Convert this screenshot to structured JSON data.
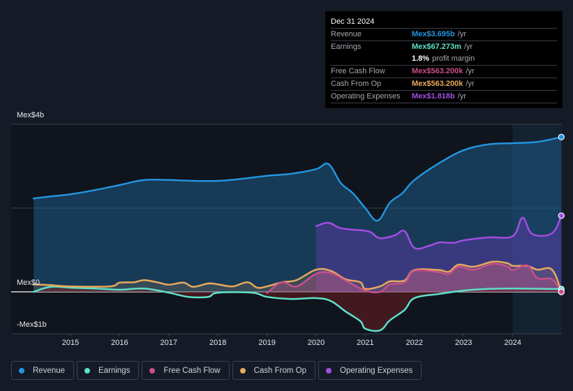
{
  "tooltip": {
    "date": "Dec 31 2024",
    "rows": [
      {
        "label": "Revenue",
        "value": "Mex$3.695b",
        "unit": "/yr",
        "color": "#2394df"
      },
      {
        "label": "Earnings",
        "value": "Mex$67.273m",
        "unit": "/yr",
        "color": "#5ee1c9"
      },
      {
        "label": "",
        "value": "1.8%",
        "unit": "profit margin",
        "color": "#ffffff"
      },
      {
        "label": "Free Cash Flow",
        "value": "Mex$563.200k",
        "unit": "/yr",
        "color": "#c94f8a"
      },
      {
        "label": "Cash From Op",
        "value": "Mex$563.200k",
        "unit": "/yr",
        "color": "#e8a95c"
      },
      {
        "label": "Operating Expenses",
        "value": "Mex$1.818b",
        "unit": "/yr",
        "color": "#a24ee0"
      }
    ]
  },
  "legend": [
    {
      "label": "Revenue",
      "color": "#2394df"
    },
    {
      "label": "Earnings",
      "color": "#5ee1c9"
    },
    {
      "label": "Free Cash Flow",
      "color": "#c94f8a"
    },
    {
      "label": "Cash From Op",
      "color": "#e8a95c"
    },
    {
      "label": "Operating Expenses",
      "color": "#a24ee0"
    }
  ],
  "chart_data": {
    "type": "area",
    "title": "",
    "xlabel": "",
    "ylabel": "",
    "units": "Mex$ billions",
    "xlim": [
      2014.25,
      2024.99
    ],
    "ylim": [
      -1,
      4
    ],
    "y_tick_labels": [
      {
        "value": 4,
        "label": "Mex$4b"
      },
      {
        "value": 0,
        "label": "Mex$0"
      },
      {
        "value": -1,
        "label": "-Mex$1b"
      }
    ],
    "gridlines": [
      4,
      2,
      0
    ],
    "x_ticks": [
      2015,
      2016,
      2017,
      2018,
      2019,
      2020,
      2021,
      2022,
      2023,
      2024
    ],
    "x_tick_labels": [
      "2015",
      "2016",
      "2017",
      "2018",
      "2019",
      "2020",
      "2021",
      "2022",
      "2023",
      "2024"
    ],
    "highlight_from": 2024,
    "legend_position": "bottom",
    "series": [
      {
        "name": "Revenue",
        "color": "#2394df",
        "x": [
          2014.25,
          2014.6,
          2015,
          2015.5,
          2016,
          2016.5,
          2017,
          2017.5,
          2018,
          2018.5,
          2019,
          2019.5,
          2020,
          2020.25,
          2020.5,
          2020.75,
          2021,
          2021.25,
          2021.5,
          2021.75,
          2022,
          2022.5,
          2023,
          2023.5,
          2024,
          2024.5,
          2024.99
        ],
        "values": [
          2.23,
          2.28,
          2.33,
          2.43,
          2.55,
          2.67,
          2.67,
          2.65,
          2.65,
          2.7,
          2.77,
          2.82,
          2.93,
          3.05,
          2.6,
          2.35,
          2.0,
          1.7,
          2.13,
          2.35,
          2.67,
          3.07,
          3.38,
          3.52,
          3.55,
          3.58,
          3.695
        ]
      },
      {
        "name": "Earnings",
        "color": "#5ee1c9",
        "x": [
          2014.25,
          2014.6,
          2015,
          2015.5,
          2016,
          2016.5,
          2017,
          2017.4,
          2017.8,
          2018,
          2018.7,
          2019,
          2019.5,
          2020,
          2020.3,
          2020.6,
          2020.9,
          2021,
          2021.3,
          2021.5,
          2021.8,
          2022,
          2022.5,
          2023,
          2023.5,
          2024,
          2024.99
        ],
        "values": [
          0.0,
          0.12,
          0.1,
          0.08,
          0.05,
          0.08,
          -0.02,
          -0.12,
          -0.12,
          -0.02,
          -0.02,
          -0.12,
          -0.17,
          -0.15,
          -0.22,
          -0.47,
          -0.7,
          -0.88,
          -0.92,
          -0.68,
          -0.43,
          -0.15,
          -0.05,
          0.03,
          0.07,
          0.08,
          0.067
        ]
      },
      {
        "name": "Free Cash Flow",
        "color": "#c94f8a",
        "x": [
          2019.0,
          2019.3,
          2019.6,
          2020,
          2020.3,
          2020.6,
          2021,
          2021.3,
          2021.5,
          2021.8,
          2022,
          2022.5,
          2022.7,
          2022.9,
          2023.2,
          2023.6,
          2023.9,
          2024,
          2024.3,
          2024.5,
          2024.8,
          2024.99
        ],
        "values": [
          -0.03,
          0.23,
          0.13,
          0.43,
          0.45,
          0.27,
          0.03,
          0.0,
          0.18,
          0.22,
          0.5,
          0.47,
          0.42,
          0.6,
          0.53,
          0.67,
          0.6,
          0.52,
          0.63,
          0.33,
          0.3,
          0.000563
        ]
      },
      {
        "name": "Cash From Op",
        "color": "#e8a95c",
        "x": [
          2014.25,
          2014.6,
          2015,
          2015.8,
          2016,
          2016.3,
          2016.5,
          2016.8,
          2017,
          2017.3,
          2017.5,
          2017.8,
          2018,
          2018.3,
          2018.6,
          2018.8,
          2019,
          2019.3,
          2019.6,
          2020,
          2020.3,
          2020.6,
          2020.9,
          2021,
          2021.3,
          2021.5,
          2021.8,
          2022,
          2022.5,
          2022.7,
          2022.9,
          2023.2,
          2023.6,
          2023.9,
          2024,
          2024.3,
          2024.5,
          2024.8,
          2024.99
        ],
        "values": [
          0.18,
          0.16,
          0.13,
          0.13,
          0.22,
          0.23,
          0.28,
          0.22,
          0.17,
          0.22,
          0.12,
          0.2,
          0.18,
          0.13,
          0.23,
          0.1,
          0.13,
          0.23,
          0.28,
          0.53,
          0.5,
          0.3,
          0.23,
          0.07,
          0.13,
          0.25,
          0.27,
          0.52,
          0.52,
          0.48,
          0.65,
          0.6,
          0.72,
          0.68,
          0.62,
          0.62,
          0.53,
          0.53,
          0.000563
        ]
      },
      {
        "name": "Operating Expenses",
        "color": "#a24ee0",
        "x": [
          2020,
          2020.25,
          2020.5,
          2020.9,
          2021.1,
          2021.3,
          2021.6,
          2021.8,
          2022,
          2022.3,
          2022.5,
          2022.8,
          2023,
          2023.5,
          2024,
          2024.2,
          2024.4,
          2024.8,
          2024.99
        ],
        "values": [
          1.57,
          1.65,
          1.52,
          1.47,
          1.43,
          1.28,
          1.35,
          1.45,
          1.05,
          1.1,
          1.18,
          1.17,
          1.23,
          1.3,
          1.33,
          1.77,
          1.38,
          1.4,
          1.818
        ]
      }
    ]
  }
}
